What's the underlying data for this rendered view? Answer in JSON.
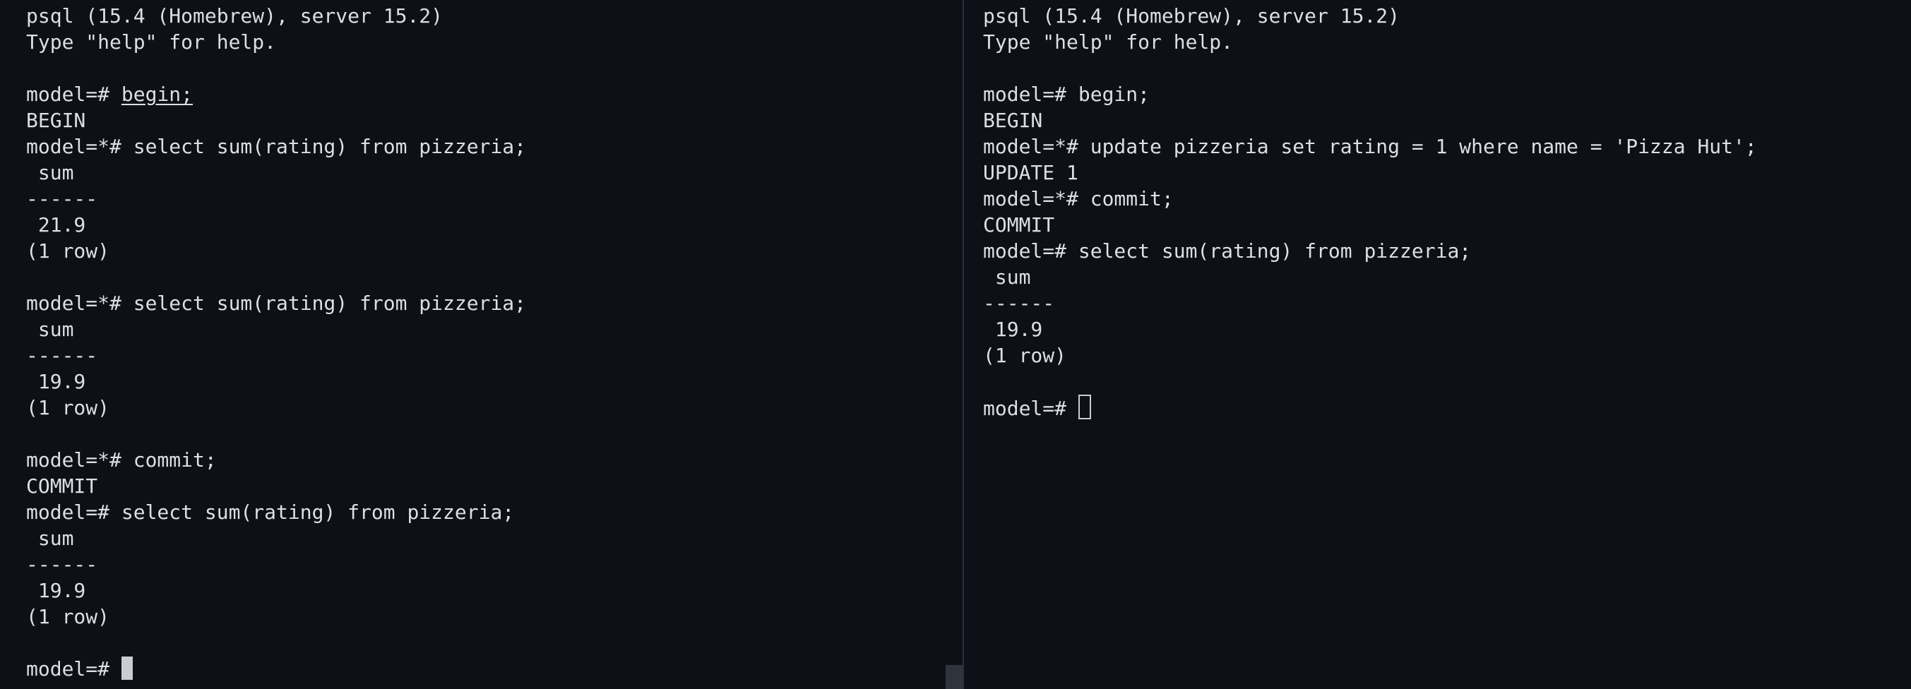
{
  "left_pane": {
    "lines": [
      "psql (15.4 (Homebrew), server 15.2)",
      "Type \"help\" for help.",
      "",
      "model=# ",
      "BEGIN",
      "model=*# select sum(rating) from pizzeria;",
      " sum",
      "------",
      " 21.9",
      "(1 row)",
      "",
      "model=*# select sum(rating) from pizzeria;",
      " sum",
      "------",
      " 19.9",
      "(1 row)",
      "",
      "model=*# commit;",
      "COMMIT",
      "model=# select sum(rating) from pizzeria;",
      " sum",
      "------",
      " 19.9",
      "(1 row)",
      "",
      "model=# "
    ],
    "underlined_command": "begin;"
  },
  "right_pane": {
    "lines": [
      "psql (15.4 (Homebrew), server 15.2)",
      "Type \"help\" for help.",
      "",
      "model=# begin;",
      "BEGIN",
      "model=*# update pizzeria set rating = 1 where name = 'Pizza Hut';",
      "UPDATE 1",
      "model=*# commit;",
      "COMMIT",
      "model=# select sum(rating) from pizzeria;",
      " sum",
      "------",
      " 19.9",
      "(1 row)",
      "",
      "model=# "
    ]
  },
  "colors": {
    "background": "#0d1117",
    "text": "#dcdfe4",
    "cursor": "#c9ccd1",
    "divider": "#2b3038"
  },
  "icons": {
    "left_cursor": "block-cursor",
    "right_cursor": "hollow-block-cursor"
  }
}
